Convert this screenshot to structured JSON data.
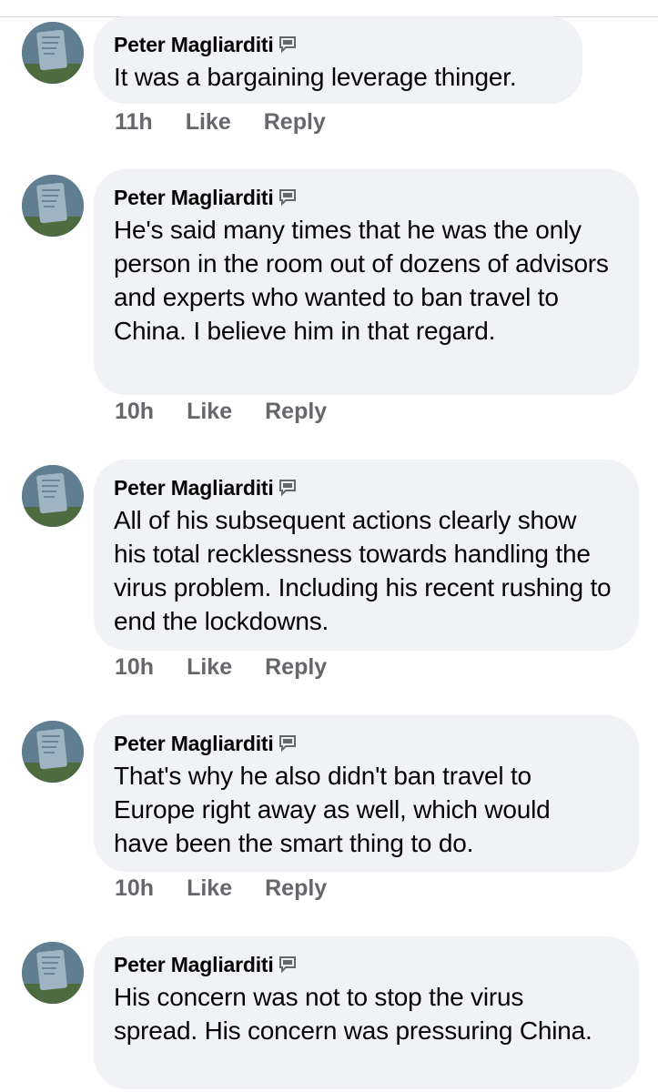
{
  "comments": [
    {
      "author": "Peter Magliarditi",
      "text": "It was a bargaining leverage thinger.",
      "time": "11h",
      "like_label": "Like",
      "reply_label": "Reply"
    },
    {
      "author": "Peter Magliarditi",
      "text": "He's said many times that he was the only person in the room out of dozens of advisors and experts who wanted to ban travel to China. I believe him in that regard.",
      "time": "10h",
      "like_label": "Like",
      "reply_label": "Reply"
    },
    {
      "author": "Peter Magliarditi",
      "text": "All of his subsequent actions clearly show his total recklessness towards handling the virus problem. Including his recent rushing to end the lockdowns.",
      "time": "10h",
      "like_label": "Like",
      "reply_label": "Reply"
    },
    {
      "author": "Peter Magliarditi",
      "text": "That's why he also didn't ban travel to Europe right away as well, which would have been the smart thing to do.",
      "time": "10h",
      "like_label": "Like",
      "reply_label": "Reply"
    },
    {
      "author": "Peter Magliarditi",
      "text": "His concern was not to stop the virus spread. His concern was pressuring China.",
      "time": "",
      "like_label": "",
      "reply_label": ""
    }
  ],
  "icons": {
    "author_badge": "translate-speech-bubble-icon",
    "avatar": "avatar-image"
  },
  "colors": {
    "bubble_bg": "#f0f2f5",
    "text": "#050505",
    "meta": "#65676b"
  }
}
